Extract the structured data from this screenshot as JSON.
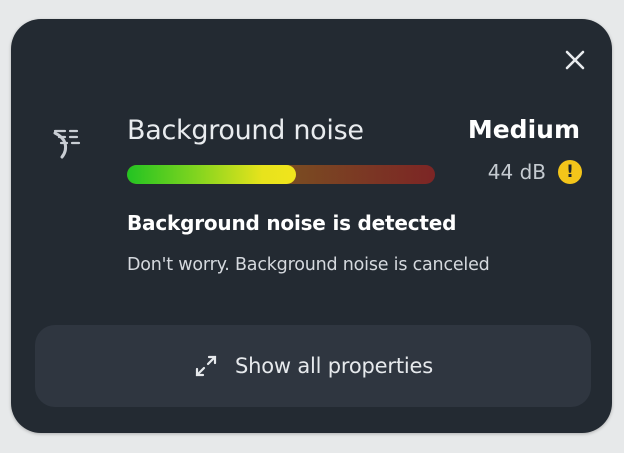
{
  "panel": {
    "title": "Background noise",
    "level_label": "Medium",
    "db_value": "44 dB",
    "meter_level_fraction": 0.55,
    "headline": "Background noise is detected",
    "subtext": "Don't worry. Background noise is canceled",
    "show_all_label": "Show all properties"
  },
  "icons": {
    "close": "close-icon",
    "noise": "noise-icon",
    "warning": "warning-icon",
    "expand": "expand-icon"
  },
  "colors": {
    "card_bg": "#232a32",
    "button_bg": "#2f3640",
    "warning": "#f3c51a",
    "meter_green": "#22c322",
    "meter_yellow": "#e7e31c",
    "meter_red": "#7c2525"
  }
}
